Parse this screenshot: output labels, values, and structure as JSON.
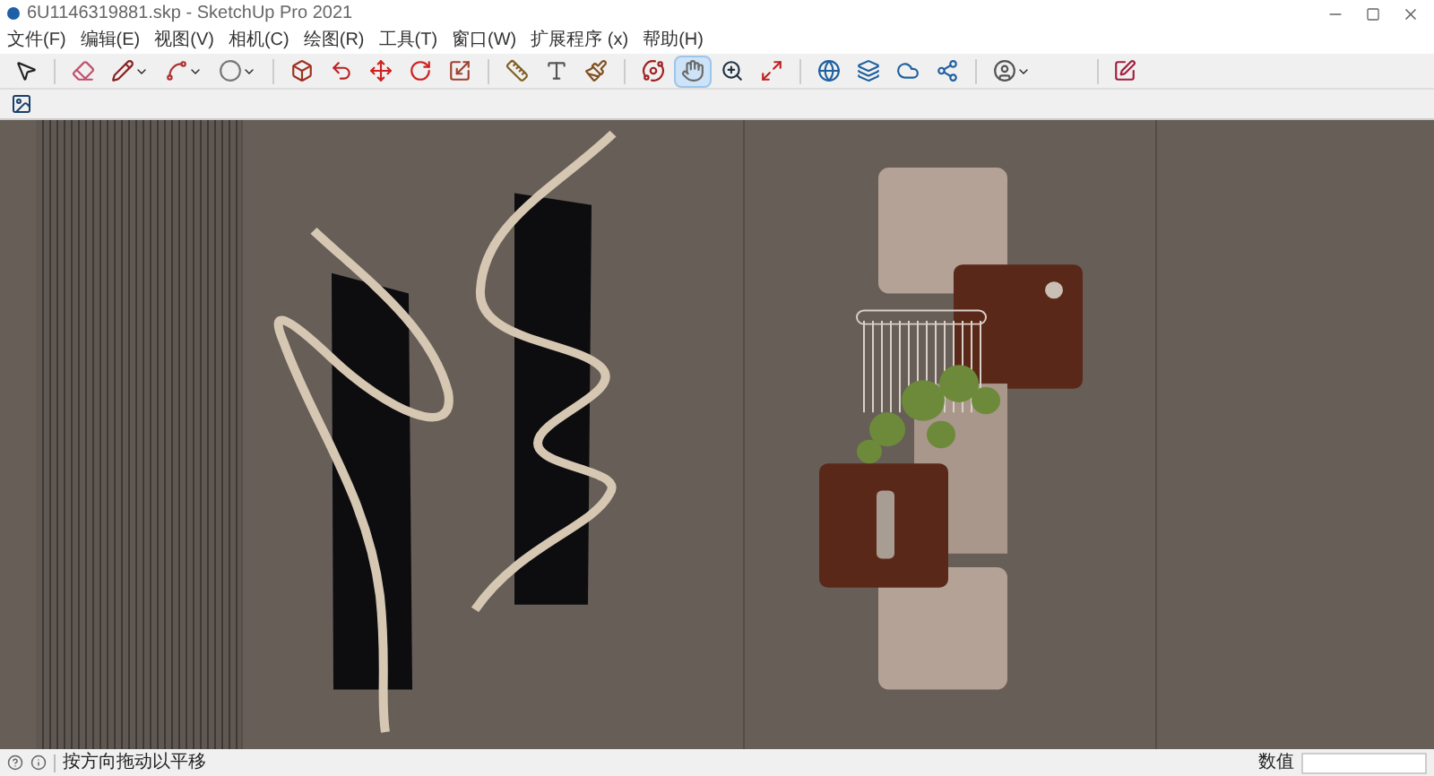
{
  "window": {
    "title": "6U1146319881.skp - SketchUp Pro 2021"
  },
  "menu": [
    "文件(F)",
    "编辑(E)",
    "视图(V)",
    "相机(C)",
    "绘图(R)",
    "工具(T)",
    "窗口(W)",
    "扩展程序 (x)",
    "帮助(H)"
  ],
  "toolbar": {
    "tools": [
      {
        "selected": false,
        "dropdown": false
      },
      {
        "selected": false,
        "dropdown": false
      },
      {
        "selected": false,
        "dropdown": true
      },
      {
        "selected": false,
        "dropdown": true
      },
      {
        "selected": false,
        "dropdown": true
      },
      {
        "selected": false,
        "dropdown": false
      },
      {
        "selected": false,
        "dropdown": false
      },
      {
        "selected": false,
        "dropdown": false
      },
      {
        "selected": false,
        "dropdown": false
      },
      {
        "selected": false,
        "dropdown": false
      },
      {
        "selected": false,
        "dropdown": false
      },
      {
        "selected": false,
        "dropdown": false
      },
      {
        "selected": false,
        "dropdown": false
      },
      {
        "selected": false,
        "dropdown": false
      },
      {
        "selected": true,
        "dropdown": false
      },
      {
        "selected": false,
        "dropdown": false
      },
      {
        "selected": false,
        "dropdown": false
      },
      {
        "selected": false,
        "dropdown": false
      },
      {
        "selected": false,
        "dropdown": false
      },
      {
        "selected": false,
        "dropdown": false
      },
      {
        "selected": false,
        "dropdown": false
      },
      {
        "selected": false,
        "dropdown": true
      }
    ]
  },
  "status_bar": {
    "hint": "按方向拖动以平移",
    "measurements_label": "数值"
  }
}
